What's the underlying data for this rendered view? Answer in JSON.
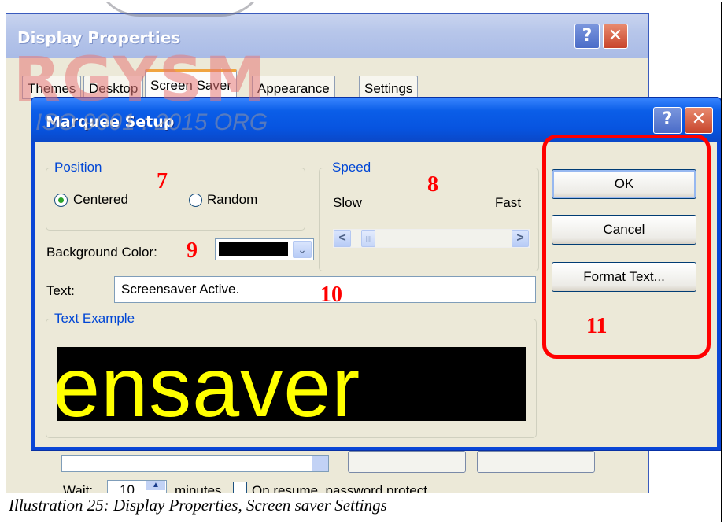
{
  "back_window": {
    "title": "Display Properties",
    "help_glyph": "?",
    "close_glyph": "✕",
    "tabs": [
      {
        "label": "Themes",
        "active": false
      },
      {
        "label": "Desktop",
        "active": false
      },
      {
        "label": "Screen Saver",
        "active": true
      },
      {
        "label": "Appearance",
        "active": false
      },
      {
        "label": "Settings",
        "active": false
      }
    ],
    "wait_label": "Wait:",
    "wait_value": "10",
    "minutes_label": "minutes",
    "resume_label": "On resume, password protect"
  },
  "marquee_dialog": {
    "title": "Marquee Setup",
    "help_glyph": "?",
    "close_glyph": "✕",
    "position": {
      "group_label": "Position",
      "options": [
        {
          "label": "Centered",
          "selected": true
        },
        {
          "label": "Random",
          "selected": false
        }
      ]
    },
    "speed": {
      "group_label": "Speed",
      "slow_label": "Slow",
      "fast_label": "Fast",
      "left_arrow": "<",
      "right_arrow": ">",
      "thumb_grip": "|||",
      "value_fraction": 0.05
    },
    "background_color": {
      "label": "Background Color:",
      "value_hex": "#000000",
      "arrow_glyph": "⌄"
    },
    "text_field": {
      "label": "Text:",
      "value": "Screensaver Active."
    },
    "text_example": {
      "group_label": "Text Example",
      "preview_text": "ensaver",
      "preview_fg": "#ffff00",
      "preview_bg": "#000000"
    },
    "buttons": {
      "ok": "OK",
      "cancel": "Cancel",
      "format_text": "Format Text..."
    }
  },
  "annotations": [
    "7",
    "8",
    "9",
    "10",
    "11"
  ],
  "annotation_color": "#ff0000",
  "watermark": {
    "main": "RGYSM",
    "sub": "ISO 9001 : 2015 ORG"
  },
  "caption": "Illustration 25: Display Properties, Screen saver Settings"
}
